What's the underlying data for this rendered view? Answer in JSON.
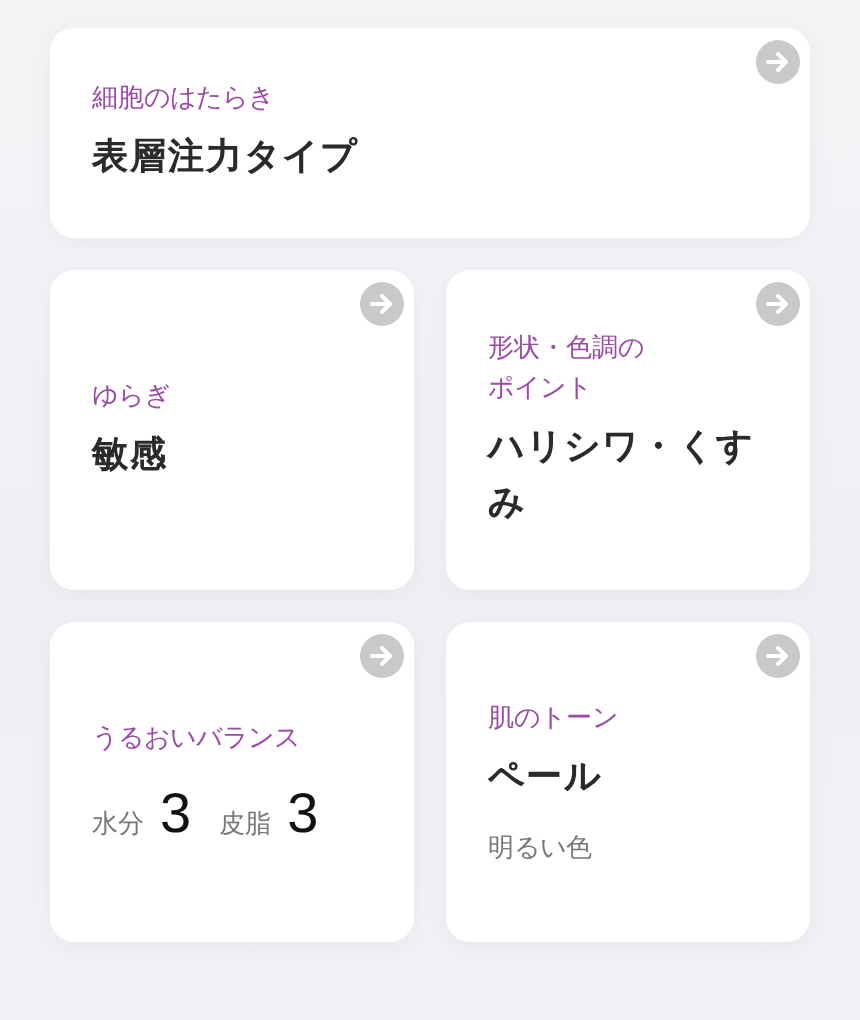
{
  "cards": [
    {
      "kind": "value",
      "wide": true,
      "label": "細胞のはたらき",
      "value": "表層注力タイプ"
    },
    {
      "kind": "value",
      "wide": false,
      "label": "ゆらぎ",
      "value": "敏感"
    },
    {
      "kind": "value",
      "wide": false,
      "label_lines": [
        "形状・色調の",
        "ポイント"
      ],
      "value": "ハリシワ・くすみ"
    },
    {
      "kind": "balance",
      "wide": false,
      "label": "うるおいバランス",
      "metrics": [
        {
          "name": "水分",
          "score": "3"
        },
        {
          "name": "皮脂",
          "score": "3"
        }
      ]
    },
    {
      "kind": "tone",
      "wide": false,
      "label": "肌のトーン",
      "value": "ペール",
      "note": "明るい色"
    }
  ]
}
